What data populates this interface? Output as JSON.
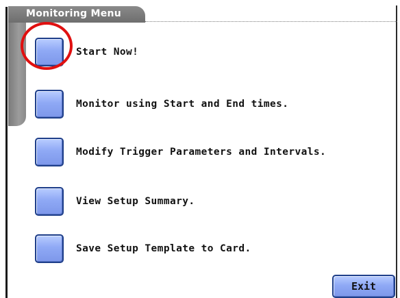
{
  "window": {
    "title": "Monitoring Menu"
  },
  "menu": {
    "items": [
      {
        "label": "Start Now!"
      },
      {
        "label": "Monitor using Start and End times."
      },
      {
        "label": "Modify Trigger Parameters and Intervals."
      },
      {
        "label": "View Setup Summary."
      },
      {
        "label": "Save Setup Template to Card."
      }
    ]
  },
  "footer": {
    "exit_label": "Exit"
  },
  "colors": {
    "button_blue": "#8fa9f5",
    "button_border": "#1f3f8a",
    "title_tab_gray": "#7c7c7c",
    "highlight_red": "#e01010"
  }
}
